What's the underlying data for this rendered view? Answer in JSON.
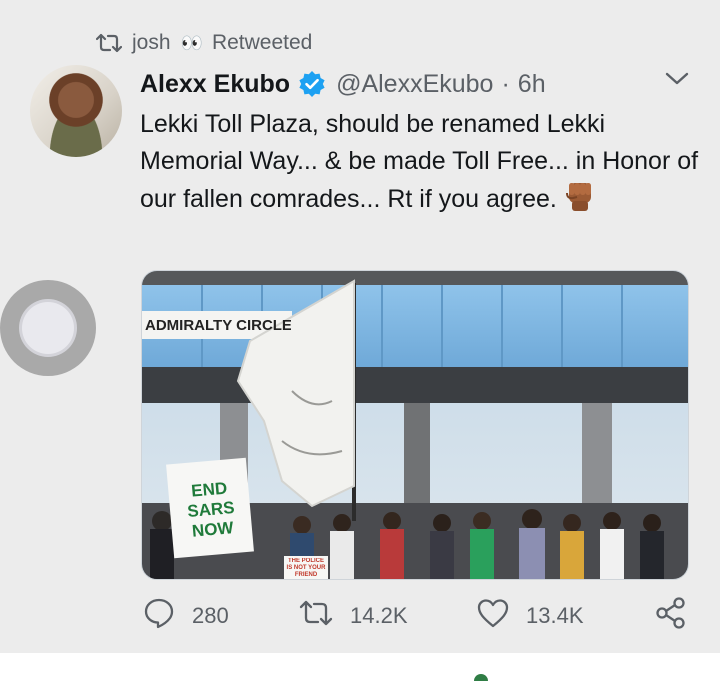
{
  "retweet_header": {
    "user": "josh",
    "eyes": "👀",
    "label": "Retweeted"
  },
  "tweet": {
    "author_name": "Alexx Ekubo",
    "handle": "@AlexxEkubo",
    "separator": "·",
    "time": "6h",
    "text": "Lekki Toll Plaza, should be renamed Lekki Memorial Way... & be made Toll Free... in Honor of our fallen comrades... Rt if you agree.",
    "emoji_icon": "raised-fist-icon"
  },
  "media": {
    "sign_text": "ADMIRALTY CIRCLE",
    "placard_text": [
      "END",
      "SARS",
      "NOW"
    ],
    "banner_text": "THE POLICE IS NOT YOUR FRIEND"
  },
  "actions": {
    "replies": "280",
    "retweets": "14.2K",
    "likes": "13.4K"
  },
  "colors": {
    "verified": "#1da1f2",
    "secondary_text": "#5b6066",
    "card_background": "#ececec"
  }
}
